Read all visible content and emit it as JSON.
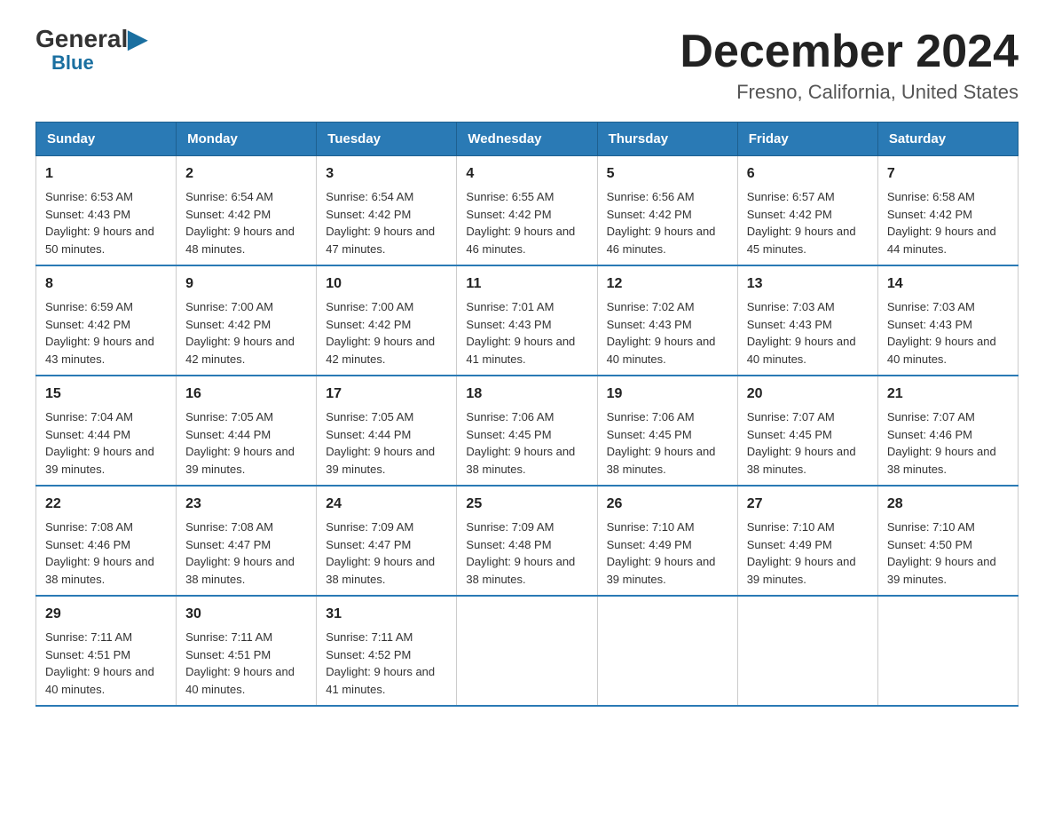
{
  "logo": {
    "general": "General",
    "blue": "Blue",
    "triangle": "▶"
  },
  "title": "December 2024",
  "subtitle": "Fresno, California, United States",
  "weekdays": [
    "Sunday",
    "Monday",
    "Tuesday",
    "Wednesday",
    "Thursday",
    "Friday",
    "Saturday"
  ],
  "weeks": [
    [
      {
        "day": "1",
        "sunrise": "6:53 AM",
        "sunset": "4:43 PM",
        "daylight": "9 hours and 50 minutes."
      },
      {
        "day": "2",
        "sunrise": "6:54 AM",
        "sunset": "4:42 PM",
        "daylight": "9 hours and 48 minutes."
      },
      {
        "day": "3",
        "sunrise": "6:54 AM",
        "sunset": "4:42 PM",
        "daylight": "9 hours and 47 minutes."
      },
      {
        "day": "4",
        "sunrise": "6:55 AM",
        "sunset": "4:42 PM",
        "daylight": "9 hours and 46 minutes."
      },
      {
        "day": "5",
        "sunrise": "6:56 AM",
        "sunset": "4:42 PM",
        "daylight": "9 hours and 46 minutes."
      },
      {
        "day": "6",
        "sunrise": "6:57 AM",
        "sunset": "4:42 PM",
        "daylight": "9 hours and 45 minutes."
      },
      {
        "day": "7",
        "sunrise": "6:58 AM",
        "sunset": "4:42 PM",
        "daylight": "9 hours and 44 minutes."
      }
    ],
    [
      {
        "day": "8",
        "sunrise": "6:59 AM",
        "sunset": "4:42 PM",
        "daylight": "9 hours and 43 minutes."
      },
      {
        "day": "9",
        "sunrise": "7:00 AM",
        "sunset": "4:42 PM",
        "daylight": "9 hours and 42 minutes."
      },
      {
        "day": "10",
        "sunrise": "7:00 AM",
        "sunset": "4:42 PM",
        "daylight": "9 hours and 42 minutes."
      },
      {
        "day": "11",
        "sunrise": "7:01 AM",
        "sunset": "4:43 PM",
        "daylight": "9 hours and 41 minutes."
      },
      {
        "day": "12",
        "sunrise": "7:02 AM",
        "sunset": "4:43 PM",
        "daylight": "9 hours and 40 minutes."
      },
      {
        "day": "13",
        "sunrise": "7:03 AM",
        "sunset": "4:43 PM",
        "daylight": "9 hours and 40 minutes."
      },
      {
        "day": "14",
        "sunrise": "7:03 AM",
        "sunset": "4:43 PM",
        "daylight": "9 hours and 40 minutes."
      }
    ],
    [
      {
        "day": "15",
        "sunrise": "7:04 AM",
        "sunset": "4:44 PM",
        "daylight": "9 hours and 39 minutes."
      },
      {
        "day": "16",
        "sunrise": "7:05 AM",
        "sunset": "4:44 PM",
        "daylight": "9 hours and 39 minutes."
      },
      {
        "day": "17",
        "sunrise": "7:05 AM",
        "sunset": "4:44 PM",
        "daylight": "9 hours and 39 minutes."
      },
      {
        "day": "18",
        "sunrise": "7:06 AM",
        "sunset": "4:45 PM",
        "daylight": "9 hours and 38 minutes."
      },
      {
        "day": "19",
        "sunrise": "7:06 AM",
        "sunset": "4:45 PM",
        "daylight": "9 hours and 38 minutes."
      },
      {
        "day": "20",
        "sunrise": "7:07 AM",
        "sunset": "4:45 PM",
        "daylight": "9 hours and 38 minutes."
      },
      {
        "day": "21",
        "sunrise": "7:07 AM",
        "sunset": "4:46 PM",
        "daylight": "9 hours and 38 minutes."
      }
    ],
    [
      {
        "day": "22",
        "sunrise": "7:08 AM",
        "sunset": "4:46 PM",
        "daylight": "9 hours and 38 minutes."
      },
      {
        "day": "23",
        "sunrise": "7:08 AM",
        "sunset": "4:47 PM",
        "daylight": "9 hours and 38 minutes."
      },
      {
        "day": "24",
        "sunrise": "7:09 AM",
        "sunset": "4:47 PM",
        "daylight": "9 hours and 38 minutes."
      },
      {
        "day": "25",
        "sunrise": "7:09 AM",
        "sunset": "4:48 PM",
        "daylight": "9 hours and 38 minutes."
      },
      {
        "day": "26",
        "sunrise": "7:10 AM",
        "sunset": "4:49 PM",
        "daylight": "9 hours and 39 minutes."
      },
      {
        "day": "27",
        "sunrise": "7:10 AM",
        "sunset": "4:49 PM",
        "daylight": "9 hours and 39 minutes."
      },
      {
        "day": "28",
        "sunrise": "7:10 AM",
        "sunset": "4:50 PM",
        "daylight": "9 hours and 39 minutes."
      }
    ],
    [
      {
        "day": "29",
        "sunrise": "7:11 AM",
        "sunset": "4:51 PM",
        "daylight": "9 hours and 40 minutes."
      },
      {
        "day": "30",
        "sunrise": "7:11 AM",
        "sunset": "4:51 PM",
        "daylight": "9 hours and 40 minutes."
      },
      {
        "day": "31",
        "sunrise": "7:11 AM",
        "sunset": "4:52 PM",
        "daylight": "9 hours and 41 minutes."
      },
      null,
      null,
      null,
      null
    ]
  ]
}
